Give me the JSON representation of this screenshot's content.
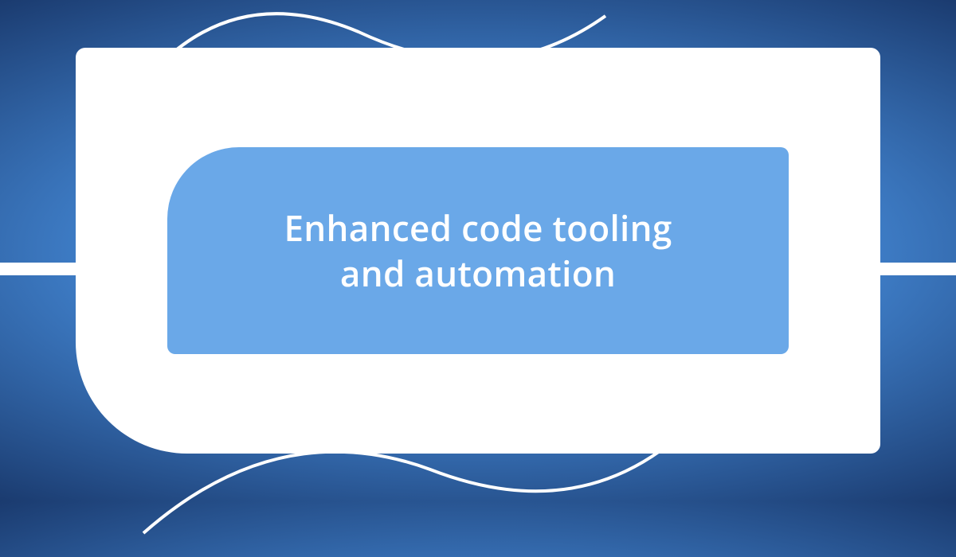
{
  "card": {
    "title_line1": "Enhanced code tooling",
    "title_line2": "and automation"
  },
  "colors": {
    "inner_card": "#6aa8e8",
    "outer_card": "#ffffff",
    "text": "#ffffff"
  }
}
